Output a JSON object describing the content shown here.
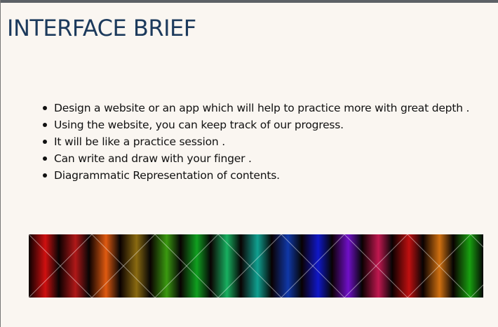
{
  "slide": {
    "title": "INTERFACE BRIEF",
    "bullets": [
      "Design a website or an app which will help to practice more with great depth .",
      "Using the website, you can keep track of our progress.",
      "It will be like a practice session .",
      "Can write and draw with your finger .",
      "Diagrammatic Representation of contents."
    ]
  },
  "colors": {
    "background": "#faf6f1",
    "title": "#1c3a5c",
    "text": "#111111",
    "band_stripes": [
      "#d01010",
      "#b01818",
      "#e05a10",
      "#8a6a10",
      "#3a9a10",
      "#10a020",
      "#18b060",
      "#10a090",
      "#1038a8",
      "#1018c8",
      "#7010c8",
      "#c01850",
      "#c01010",
      "#d07010",
      "#18a010"
    ]
  }
}
